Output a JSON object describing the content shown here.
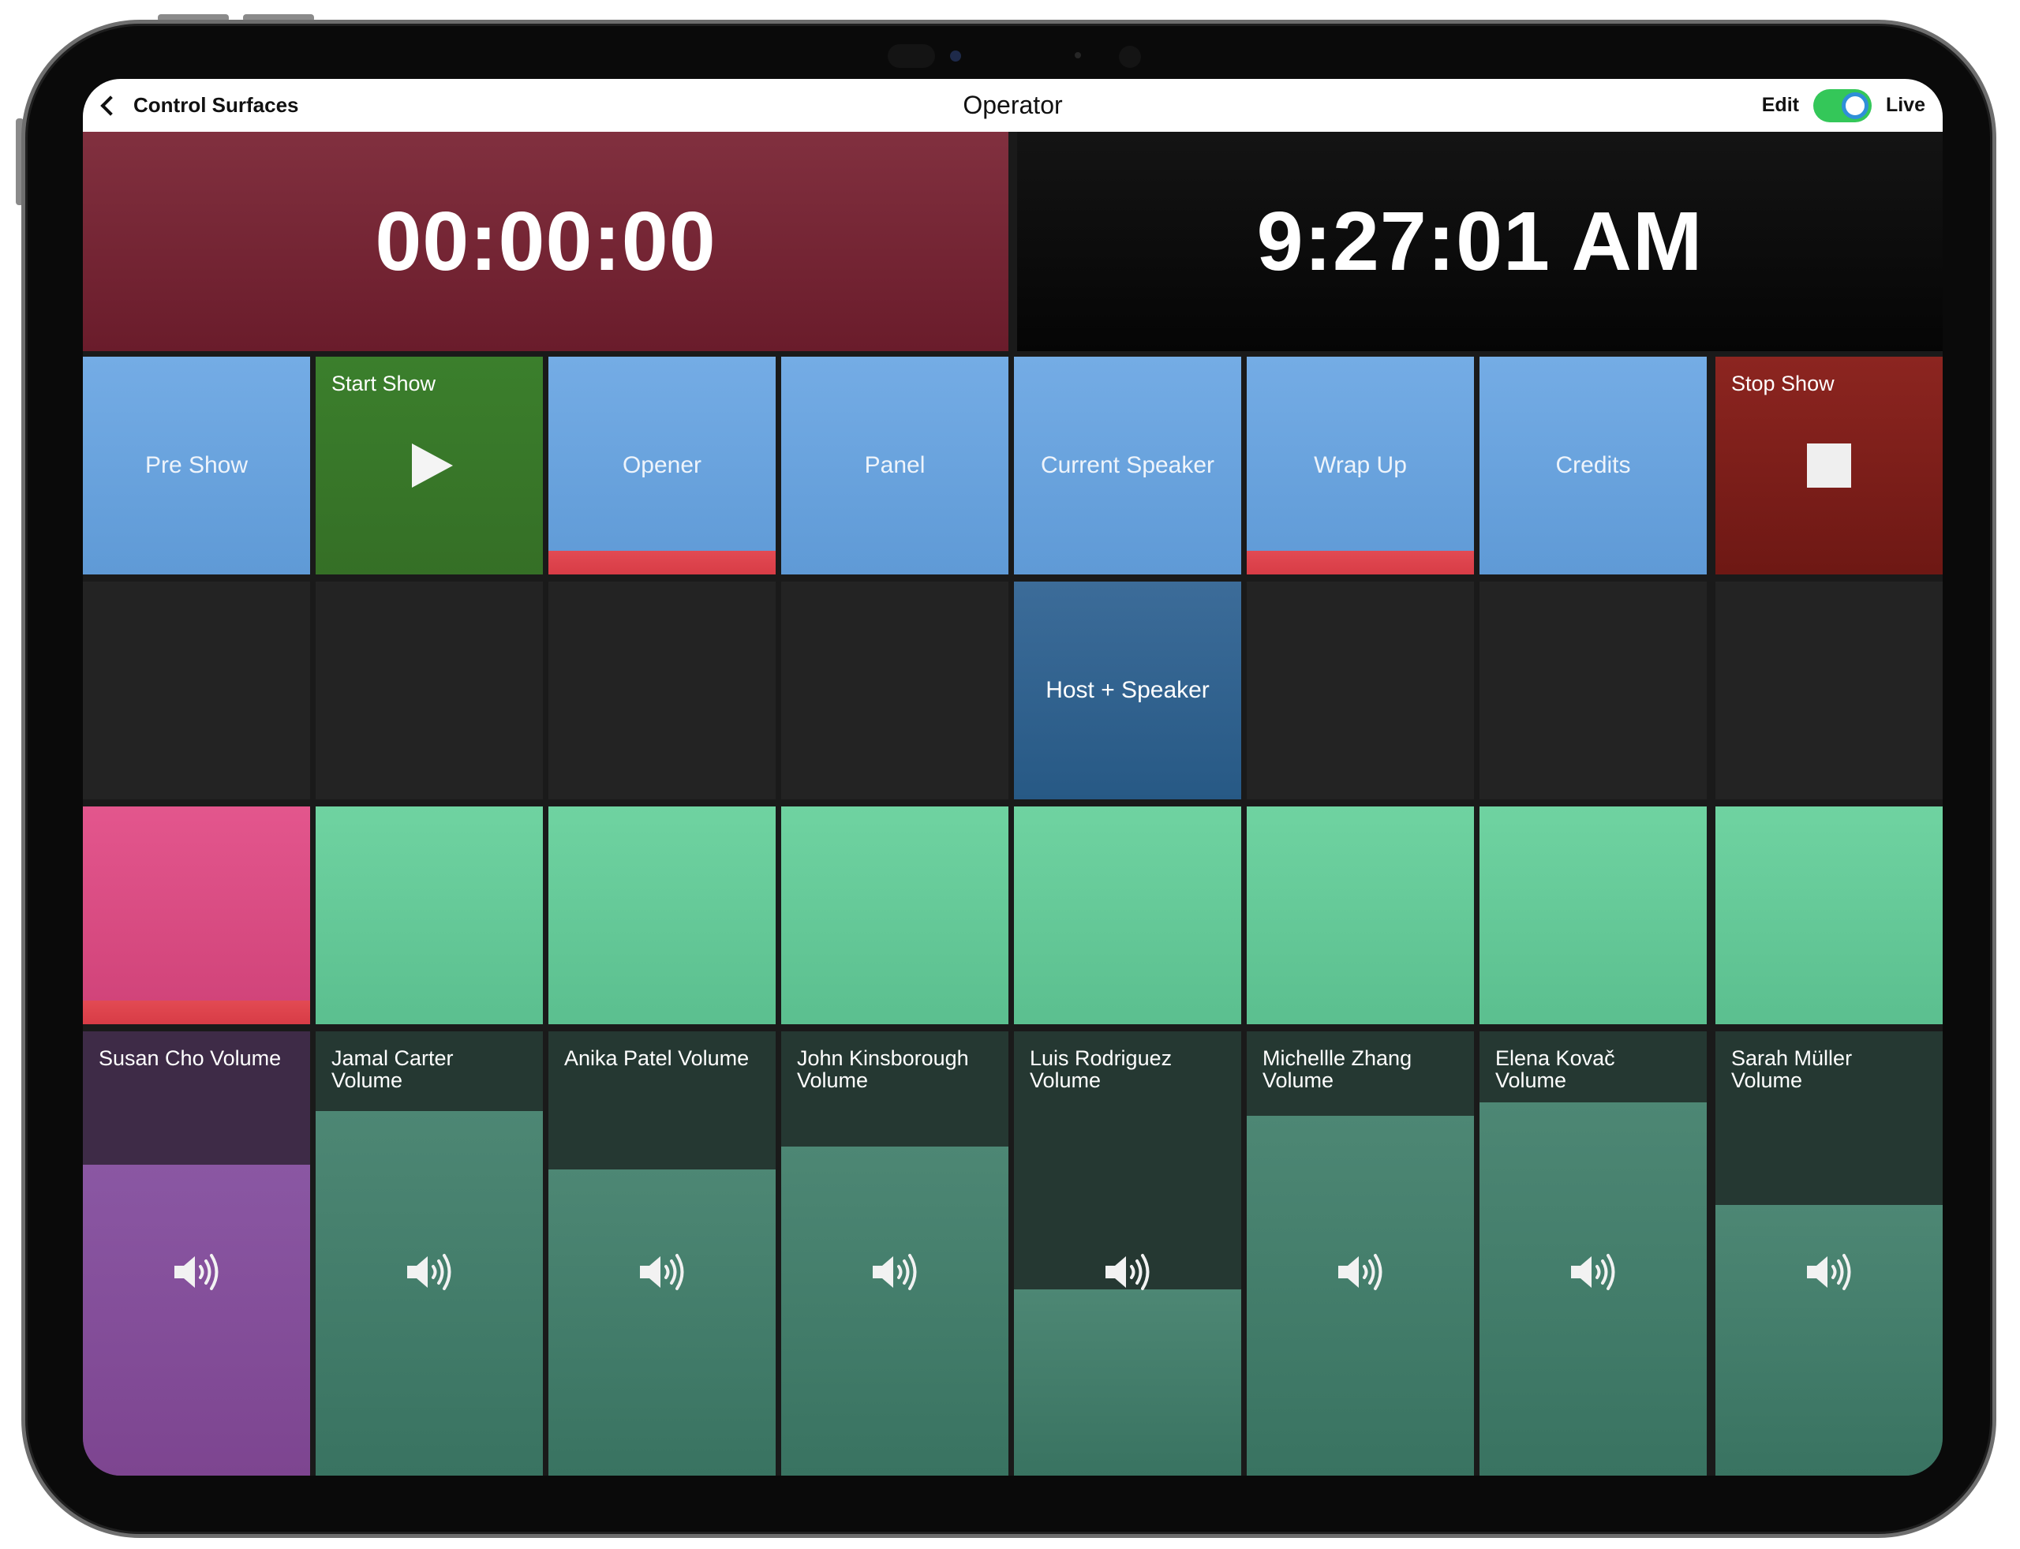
{
  "nav": {
    "back_label": "Control Surfaces",
    "title": "Operator",
    "edit_label": "Edit",
    "live_label": "Live",
    "toggle_on": true
  },
  "clocks": {
    "countdown": "00:00:00",
    "time_of_day": "9:27:01 AM"
  },
  "scenes": [
    {
      "label": "Pre Show"
    },
    {
      "label": "Start Show"
    },
    {
      "label": "Opener",
      "active": true
    },
    {
      "label": "Panel"
    },
    {
      "label": "Current Speaker"
    },
    {
      "label": "Wrap Up",
      "active": true
    },
    {
      "label": "Credits"
    },
    {
      "label": "Stop Show"
    }
  ],
  "layouts": [
    {
      "label": ""
    },
    {
      "label": ""
    },
    {
      "label": ""
    },
    {
      "label": ""
    },
    {
      "label": "Host + Speaker"
    },
    {
      "label": ""
    },
    {
      "label": ""
    },
    {
      "label": ""
    }
  ],
  "mutes": [
    {
      "active": true
    },
    {
      "active": false
    },
    {
      "active": false
    },
    {
      "active": false
    },
    {
      "active": false
    },
    {
      "active": false
    },
    {
      "active": false
    },
    {
      "active": false
    }
  ],
  "volumes": [
    {
      "label": "Susan Cho Volume",
      "level": 0.7
    },
    {
      "label": "Jamal Carter Volume",
      "level": 0.82
    },
    {
      "label": "Anika Patel Volume",
      "level": 0.69
    },
    {
      "label": "John Kinsborough Volume",
      "level": 0.74
    },
    {
      "label": "Luis Rodriguez Volume",
      "level": 0.42
    },
    {
      "label": "Michellle Zhang Volume",
      "level": 0.81
    },
    {
      "label": "Elena Kovač Volume",
      "level": 0.84
    },
    {
      "label": "Sarah Müller Volume",
      "level": 0.61
    }
  ],
  "colors": {
    "countdown_bg": "#7c2a3b",
    "clock_bg": "#0b0b0b",
    "scene_blue": "#6aa3de",
    "live_toggle": "#34c759"
  },
  "icons": {
    "back": "chevron-left-icon",
    "start": "play-icon",
    "stop": "stop-icon",
    "volume": "speaker-volume-icon"
  }
}
